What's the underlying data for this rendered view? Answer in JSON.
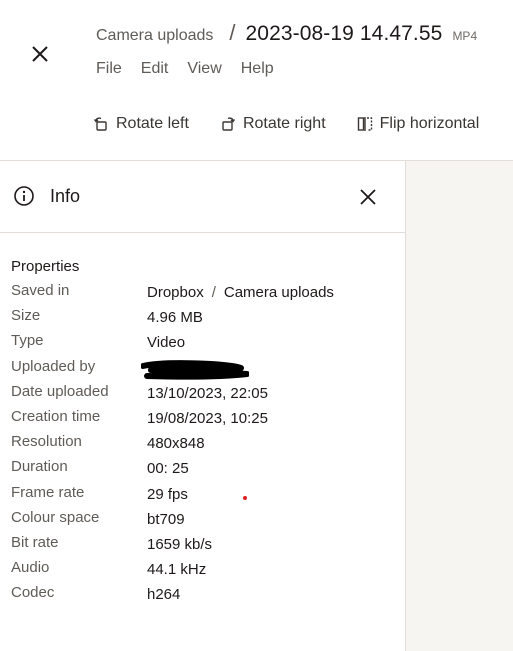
{
  "header": {
    "folder": "Camera uploads",
    "separator": "/",
    "file_name": "2023-08-19 14.47.55",
    "file_ext": "MP4"
  },
  "menu": [
    "File",
    "Edit",
    "View",
    "Help"
  ],
  "toolbar": {
    "rotate_left": "Rotate left",
    "rotate_right": "Rotate right",
    "flip_horizontal": "Flip horizontal"
  },
  "info": {
    "title": "Info",
    "section_title": "Properties",
    "properties": [
      {
        "key": "Saved in",
        "value": ""
      },
      {
        "key": "Size",
        "value": "4.96 MB"
      },
      {
        "key": "Type",
        "value": "Video"
      },
      {
        "key": "Uploaded by",
        "value": ""
      },
      {
        "key": "Date uploaded",
        "value": "13/10/2023, 22:05"
      },
      {
        "key": "Creation time",
        "value": "19/08/2023, 10:25"
      },
      {
        "key": "Resolution",
        "value": "480x848"
      },
      {
        "key": "Duration",
        "value": "00: 25"
      },
      {
        "key": "Frame rate",
        "value": "29 fps"
      },
      {
        "key": "Colour space",
        "value": "bt709"
      },
      {
        "key": "Bit rate",
        "value": "1659 kb/s"
      },
      {
        "key": "Audio",
        "value": "44.1 kHz"
      },
      {
        "key": "Codec",
        "value": "h264"
      }
    ],
    "saved_in_path": [
      "Dropbox",
      "Camera uploads"
    ],
    "saved_in_sep": "/"
  }
}
